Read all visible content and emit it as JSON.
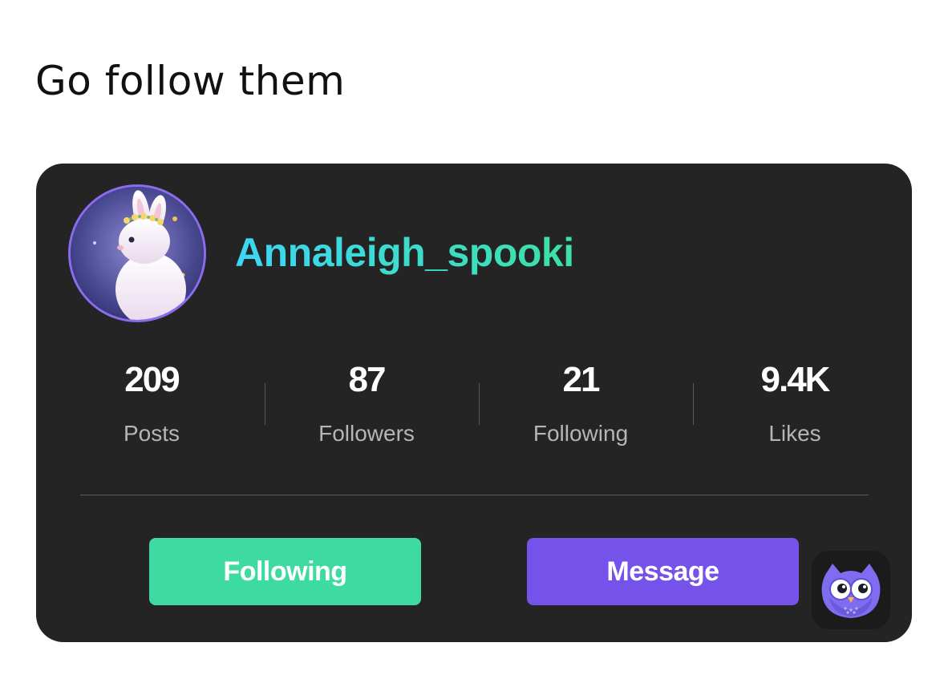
{
  "caption": "Go follow them",
  "profile": {
    "username": "Annaleigh_spooki",
    "stats": [
      {
        "value": "209",
        "label": "Posts"
      },
      {
        "value": "87",
        "label": "Followers"
      },
      {
        "value": "21",
        "label": "Following"
      },
      {
        "value": "9.4K",
        "label": "Likes"
      }
    ],
    "following_button": "Following",
    "message_button": "Message"
  },
  "colors": {
    "card_background": "#242424",
    "username_gradient_start": "#3dd6f5",
    "username_gradient_end": "#3ee0a5",
    "following_button": "#3ddba2",
    "message_button": "#7552ea",
    "avatar_ring": "#8b6cf0"
  },
  "icons": {
    "avatar": "white-bunny-with-flower-crown",
    "app_logo": "purple-owl-icon"
  }
}
